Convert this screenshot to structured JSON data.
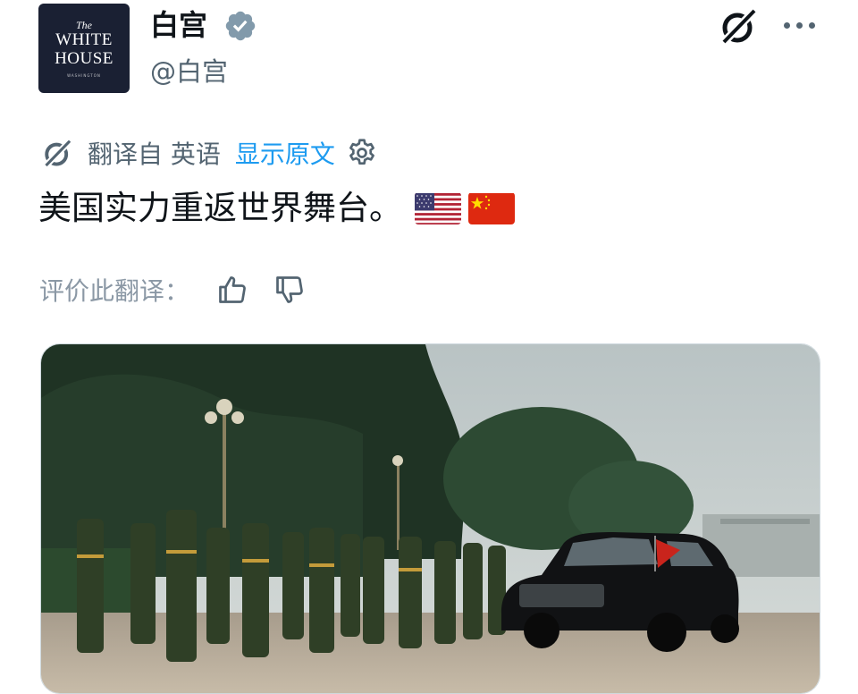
{
  "account": {
    "avatar_line_small": "The",
    "avatar_line1": "WHITE",
    "avatar_line2": "HOUSE",
    "avatar_sub": "WASHINGTON",
    "display_name": "白宫",
    "handle": "@白宫",
    "verified": true
  },
  "translation": {
    "from_label": "翻译自 英语",
    "show_original": "显示原文"
  },
  "tweet": {
    "text": "美国实力重返世界舞台。",
    "flags": [
      "us-flag",
      "china-flag"
    ]
  },
  "rating": {
    "label": "评价此翻译："
  },
  "media": {
    "description_icon": "photo"
  },
  "colors": {
    "accent": "#1d9bf0",
    "muted": "#536471",
    "verified": "#829aab",
    "avatar_bg": "#1a2033"
  }
}
